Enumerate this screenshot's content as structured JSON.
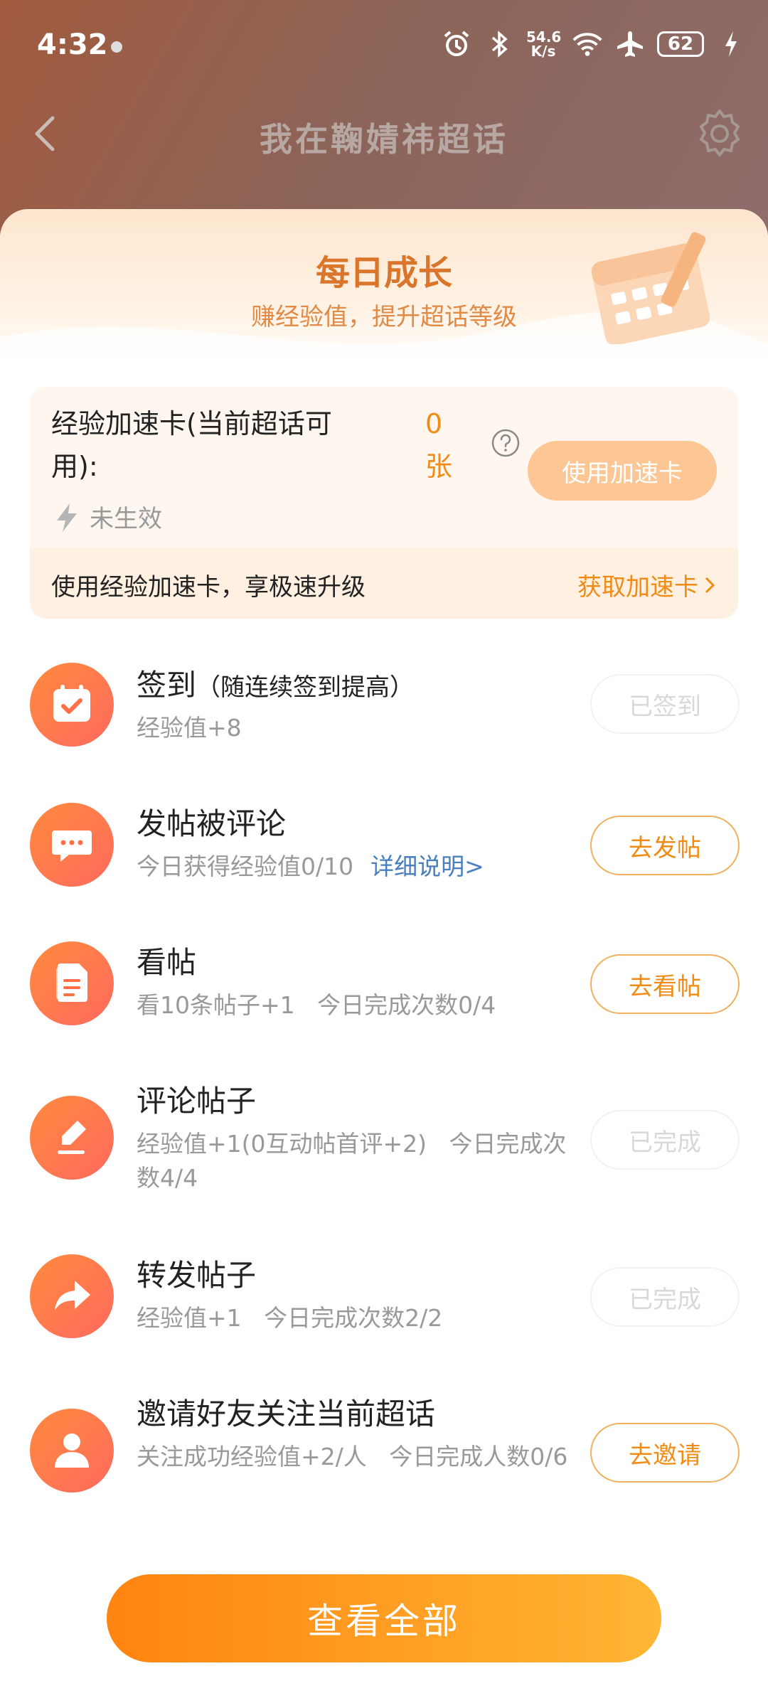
{
  "status_bar": {
    "time": "4:32",
    "net_speed_value": "54.6",
    "net_speed_unit": "K/s",
    "battery": "62"
  },
  "nav": {
    "title": "我在鞠婧祎超话"
  },
  "banner": {
    "title": "每日成长",
    "subtitle": "赚经验值，提升超话等级"
  },
  "boost": {
    "label": "经验加速卡(当前超话可用):",
    "count": "0 张",
    "button": "使用加速卡",
    "status": "未生效",
    "footer_text": "使用经验加速卡，享极速升级",
    "footer_link": "获取加速卡"
  },
  "tasks": [
    {
      "title": "签到",
      "title_note": "（随连续签到提高）",
      "desc": "经验值+8",
      "button": "已签到",
      "done": true,
      "icon": "calendar-check-icon"
    },
    {
      "title": "发帖被评论",
      "desc": "今日获得经验值0/10",
      "link": "详细说明>",
      "button": "去发帖",
      "done": false,
      "icon": "chat-bubble-icon"
    },
    {
      "title": "看帖",
      "desc": "看10条帖子+1   今日完成次数0/4",
      "button": "去看帖",
      "done": false,
      "icon": "document-icon"
    },
    {
      "title": "评论帖子",
      "desc": "经验值+1(0互动帖首评+2)   今日完成次数4/4",
      "button": "已完成",
      "done": true,
      "icon": "edit-icon"
    },
    {
      "title": "转发帖子",
      "desc": "经验值+1   今日完成次数2/2",
      "button": "已完成",
      "done": true,
      "icon": "share-arrow-icon"
    },
    {
      "title": "邀请好友关注当前超话",
      "desc": "关注成功经验值+2/人   今日完成人数0/6",
      "button": "去邀请",
      "done": false,
      "icon": "person-icon"
    }
  ],
  "view_all": "查看全部",
  "colors": {
    "accent": "#f08c16",
    "link": "#4a7fbf",
    "icon_gradient_start": "#ff8a3d",
    "icon_gradient_end": "#ff6a5e"
  }
}
